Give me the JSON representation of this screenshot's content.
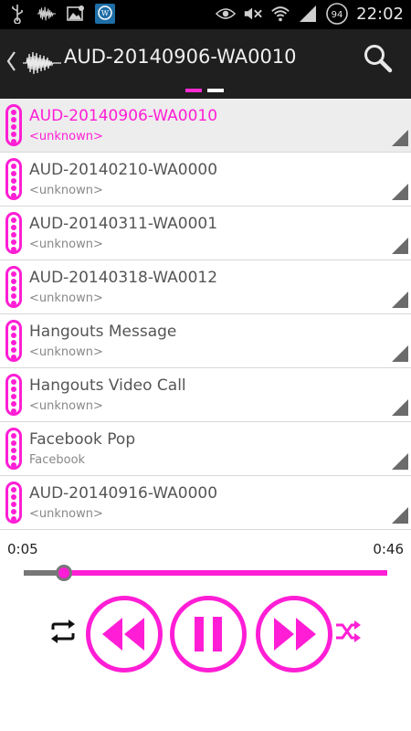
{
  "status_bar": {
    "time": "22:02",
    "battery_level": "94",
    "icons": [
      "usb-icon",
      "waveform-notification-icon",
      "image-icon",
      "wordpress-icon",
      "eye-icon",
      "mute-icon",
      "wifi-icon",
      "signal-icon",
      "battery-icon"
    ]
  },
  "action_bar": {
    "title": "AUD-20140906-WA0010",
    "pager_pages": 2,
    "pager_active_index": 0
  },
  "playlist": {
    "selected_index": 0,
    "items": [
      {
        "title": "AUD-20140906-WA0010",
        "subtitle": "<unknown>"
      },
      {
        "title": "AUD-20140210-WA0000",
        "subtitle": "<unknown>"
      },
      {
        "title": "AUD-20140311-WA0001",
        "subtitle": "<unknown>"
      },
      {
        "title": "AUD-20140318-WA0012",
        "subtitle": "<unknown>"
      },
      {
        "title": "Hangouts Message",
        "subtitle": "<unknown>"
      },
      {
        "title": "Hangouts Video Call",
        "subtitle": "<unknown>"
      },
      {
        "title": "Facebook Pop",
        "subtitle": "Facebook"
      },
      {
        "title": "AUD-20140916-WA0000",
        "subtitle": "<unknown>"
      }
    ]
  },
  "player": {
    "elapsed": "0:05",
    "duration": "0:46",
    "progress_fraction": 0.11
  },
  "colors": {
    "accent": "#ff1ed5",
    "actionbar_bg": "#1f1f1f",
    "statusbar_bg": "#000000"
  }
}
